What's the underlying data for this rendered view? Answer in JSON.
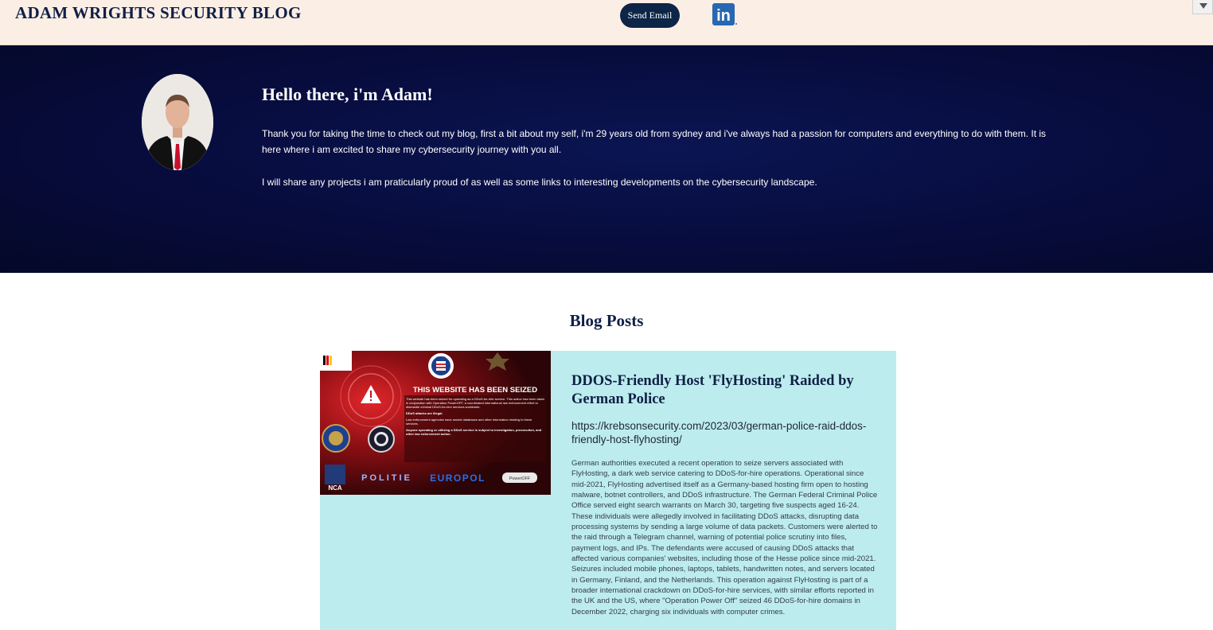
{
  "header": {
    "site_title": "ADAM WRIGHTS SECURITY BLOG",
    "send_email_label": "Send Email",
    "linkedin_icon": "linkedin-icon",
    "linkedin_text": "in"
  },
  "hero": {
    "heading": "Hello there, i'm Adam!",
    "paragraph_1": "Thank you for taking the time to check out my blog, first a bit about my self, i'm 29 years old from sydney and i've always had a passion for computers and everything to do with them. It is here where i am excited to share my cybersecurity journey with you all.",
    "paragraph_2": "I will share any projects i am praticularly proud of as well as some links to interesting developments on the cybersecurity landscape."
  },
  "blog": {
    "section_title": "Blog Posts",
    "posts": [
      {
        "title": "DDOS-Friendly Host 'FlyHosting' Raided by German Police",
        "link": "https://krebsonsecurity.com/2023/03/german-police-raid-ddos-friendly-host-flyhosting/",
        "body": "German authorities executed a recent operation to seize servers associated with FlyHosting, a dark web service catering to DDoS-for-hire operations. Operational since mid-2021, FlyHosting advertised itself as a Germany-based hosting firm open to hosting malware, botnet controllers, and DDoS infrastructure. The German Federal Criminal Police Office served eight search warrants on March 30, targeting five suspects aged 16-24. These individuals were allegedly involved in facilitating DDoS attacks, disrupting data processing systems by sending a large volume of data packets. Customers were alerted to the raid through a Telegram channel, warning of potential police scrutiny into files, payment logs, and IPs. The defendants were accused of causing DDoS attacks that affected various companies' websites, including those of the Hesse police since mid-2021. Seizures included mobile phones, laptops, tablets, handwritten notes, and servers located in Germany, Finland, and the Netherlands. This operation against FlyHosting is part of a broader international crackdown on DDoS-for-hire services, with similar efforts reported in the UK and the US, where \"Operation Power Off\" seized 46 DDoS-for-hire domains in December 2022, charging six individuals with computer crimes.",
        "image": {
          "seized_heading": "THIS WEBSITE HAS BEEN SEIZED",
          "seized_text": "This website has been seized for operating as a DDoS-for-hire service. This action has been taken in conjunction with Operation PowerOFF, a coordinated international law enforcement effort to dismantle criminal DDoS-for-hire services worldwide.",
          "illegal_text": "DDoS attacks are illegal.",
          "records_text": "Law enforcement agencies have seized databases and other information relating to these services.",
          "warning_text": "Anyone operating or utilizing a DDoS service is subject to investigation, prosecution, and other law enforcement action.",
          "logo_politie": "POLITIE",
          "logo_europol": "EUROPOL",
          "logo_nca": "NCA",
          "logo_poweroff": "PowerOFF",
          "logo_hessen": "HESSEN"
        }
      }
    ]
  }
}
